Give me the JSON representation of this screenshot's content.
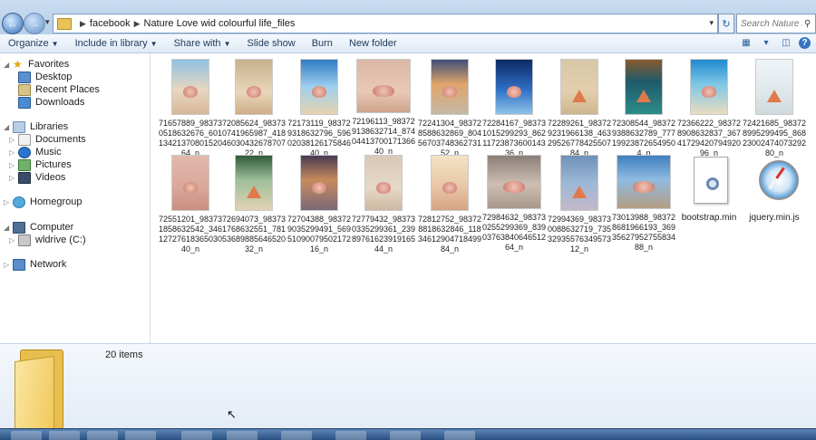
{
  "search": {
    "placeholder": "Search Nature Lo..."
  },
  "address": {
    "crumbs": [
      "facebook",
      "Nature Love wid colourful life_files"
    ]
  },
  "toolbar": {
    "organize": "Organize",
    "include": "Include in library",
    "share": "Share with",
    "slideshow": "Slide show",
    "burn": "Burn",
    "newfolder": "New folder"
  },
  "nav": {
    "favorites": "Favorites",
    "desktop": "Desktop",
    "recent": "Recent Places",
    "downloads": "Downloads",
    "libraries": "Libraries",
    "documents": "Documents",
    "music": "Music",
    "pictures": "Pictures",
    "videos": "Videos",
    "homegroup": "Homegroup",
    "computer": "Computer",
    "drive": "wldrive (C:)",
    "network": "Network"
  },
  "files": [
    {
      "name": "71657889_983730518632676_6011342137080152064_n"
    },
    {
      "name": "72085624_983730741965987_4184603043267870722_n"
    },
    {
      "name": "72173119_983729318632796_5960203812617584640_n"
    },
    {
      "name": "72196113_983729138632714_8740441370017136640_n"
    },
    {
      "name": "72241304_983728588632869_8045670374836273152_n"
    },
    {
      "name": "72284167_983731015299293_8621172387360014336_n"
    },
    {
      "name": "72289261_983729231966138_4632952677842550784_n"
    },
    {
      "name": "72308544_983729388632789_777199238726549504_n"
    },
    {
      "name": "72366222_983728908632837_3674172942079492096_n"
    },
    {
      "name": "72421685_983728995299495_8682300247407329280_n"
    },
    {
      "name": "72551201_983731858632542_3461272761836503040_n"
    },
    {
      "name": "72694073_983731768632551_7815368988564652032_n"
    },
    {
      "name": "72704388_983729035299491_5695109007950217216_n"
    },
    {
      "name": "72779432_983730335299361_2398976162391916544_n"
    },
    {
      "name": "72812752_983728818632846_1183461290471849984_n"
    },
    {
      "name": "72984632_983730255299369_8390376384064651264_n"
    },
    {
      "name": "72994369_983730088632719_7353293557634957312_n"
    },
    {
      "name": "73013988_983728681966193_3693562795275583488_n"
    },
    {
      "name": "bootstrap.min"
    },
    {
      "name": "jquery.min.js"
    }
  ],
  "status": {
    "count": "20 items"
  }
}
